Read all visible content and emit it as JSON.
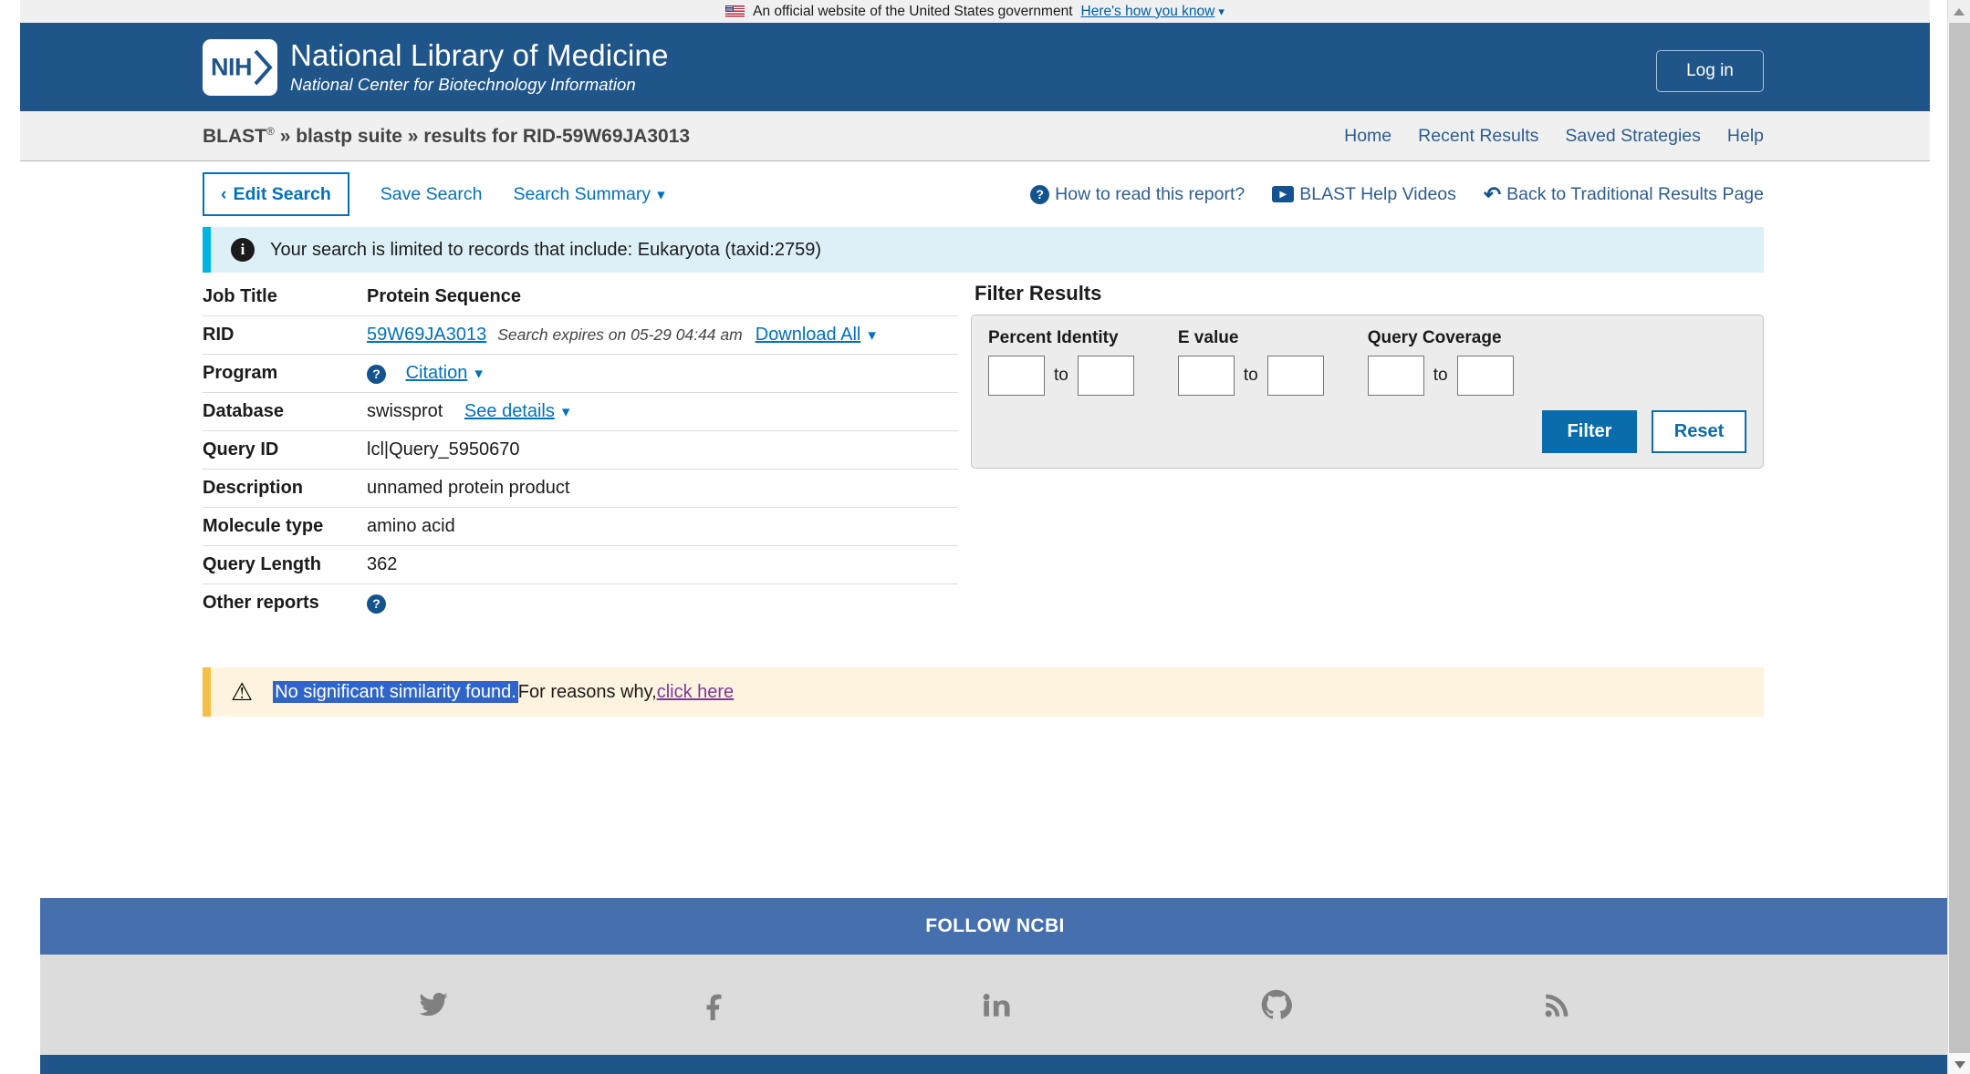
{
  "gov_banner": {
    "text": "An official website of the United States government",
    "link": "Here's how you know",
    "flag_icon": "us-flag-icon"
  },
  "header": {
    "logo_badge": "NIH",
    "title": "National Library of Medicine",
    "subtitle": "National Center for Biotechnology Information",
    "login_label": "Log in"
  },
  "navbar": {
    "brand": "BLAST",
    "registered_mark": "®",
    "crumb_sep1": "»",
    "crumb_suite": "blastp suite",
    "crumb_sep2": "»",
    "crumb_results": "results for RID-59W69JA3013",
    "links": [
      {
        "label": "Home"
      },
      {
        "label": "Recent Results"
      },
      {
        "label": "Saved Strategies"
      },
      {
        "label": "Help"
      }
    ]
  },
  "toolbar": {
    "edit_search": "Edit Search",
    "edit_search_caret": "‹",
    "save_search": "Save Search",
    "search_summary": "Search Summary",
    "how_to_read": "How to read this report?",
    "help_videos": "BLAST Help Videos",
    "back_traditional": "Back to Traditional Results Page",
    "icons": {
      "question": "question-mark-icon",
      "video": "video-play-icon",
      "back": "back-arrow-icon"
    }
  },
  "info_banner": {
    "icon": "info-icon",
    "text": "Your search is limited to records that include: Eukaryota (taxid:2759)"
  },
  "details": {
    "rows": [
      {
        "label": "Job Title",
        "value": "Protein Sequence"
      },
      {
        "label": "RID",
        "value": "59W69JA3013"
      },
      {
        "label": "Program",
        "value": ""
      },
      {
        "label": "Database",
        "value": "swissprot"
      },
      {
        "label": "Query ID",
        "value": "lcl|Query_5950670"
      },
      {
        "label": "Description",
        "value": "unnamed protein product"
      },
      {
        "label": "Molecule type",
        "value": "amino acid"
      },
      {
        "label": "Query Length",
        "value": "362"
      },
      {
        "label": "Other reports",
        "value": ""
      }
    ],
    "rid_expires": "Search expires on 05-29 04:44 am",
    "download_all": "Download All",
    "citation": "Citation",
    "see_details": "See details",
    "caret": "▾"
  },
  "filter": {
    "title": "Filter Results",
    "groups": [
      {
        "label": "Percent Identity",
        "from": "",
        "to": ""
      },
      {
        "label": "E value",
        "from": "",
        "to": ""
      },
      {
        "label": "Query Coverage",
        "from": "",
        "to": ""
      }
    ],
    "to_word": "to",
    "filter_button": "Filter",
    "reset_button": "Reset"
  },
  "warning": {
    "icon": "warning-triangle-icon",
    "selected_text": "No significant similarity found.",
    "text": "For reasons why,",
    "link": "click here"
  },
  "footer": {
    "follow_title": "FOLLOW NCBI",
    "socials": [
      {
        "name": "twitter-icon"
      },
      {
        "name": "facebook-icon"
      },
      {
        "name": "linkedin-icon"
      },
      {
        "name": "github-icon"
      },
      {
        "name": "rss-icon"
      }
    ]
  },
  "colors": {
    "nlm_blue": "#20558a",
    "link_blue": "#0071bc",
    "nav_blue": "#2c5d91",
    "info_accent": "#00b5e2",
    "info_bg": "#ddf0f7",
    "warn_accent": "#f5bf45",
    "warn_bg": "#fdf3de",
    "selection_blue": "#3064c8",
    "visited_purple": "#7a3a96",
    "footer_blue": "#466fad"
  }
}
